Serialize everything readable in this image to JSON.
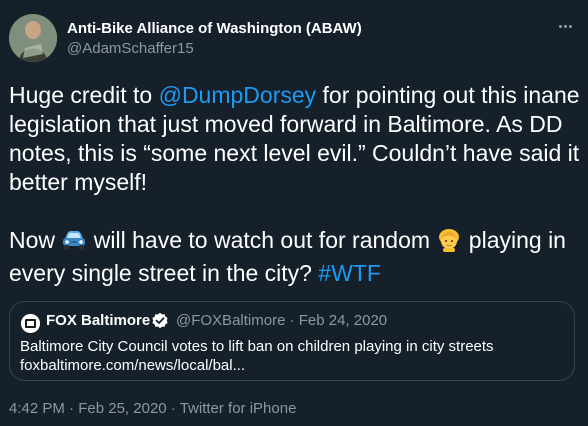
{
  "tweet": {
    "author_name": "Anti-Bike Alliance of Washington (ABAW)",
    "author_handle": "@AdamSchaffer15",
    "body": {
      "p1_pre": "Huge credit to ",
      "p1_mention": "@DumpDorsey",
      "p1_post": " for pointing out this inane legislation that just moved forward in Baltimore. As DD notes, this is “some next level evil.” Couldn’t have said it better myself!",
      "p2_pre": "Now ",
      "p2_mid": " will have to watch out for random ",
      "p2_post": " playing in every single street in the city? ",
      "p2_hashtag": "#WTF"
    },
    "emoji": [
      "car-emoji",
      "child-emoji"
    ],
    "time": "4:42 PM",
    "date": "Feb 25, 2020",
    "source": "Twitter for iPhone",
    "separator": " · "
  },
  "quote": {
    "name": "FOX Baltimore",
    "meta": "@FOXBaltimore · Feb 24, 2020",
    "text": "Baltimore City Council votes to lift ban on children playing in city streets",
    "link": "foxbaltimore.com/news/local/bal..."
  },
  "colors": {
    "background": "#15202b",
    "link": "#1d9bf0",
    "secondary_text": "#8899a6",
    "border": "#38444d"
  }
}
